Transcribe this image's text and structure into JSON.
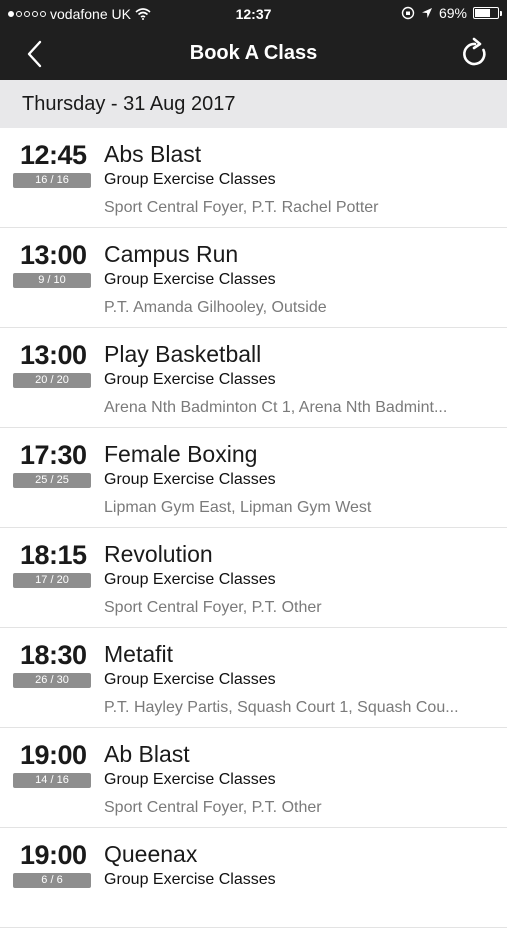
{
  "status_bar": {
    "carrier": "vodafone UK",
    "signal_dots_on": 1,
    "time": "12:37",
    "battery": "69%",
    "battery_level": 0.69
  },
  "nav": {
    "title": "Book A Class",
    "back_icon": "chevron-left-icon",
    "refresh_icon": "refresh-icon"
  },
  "date_header": "Thursday - 31 Aug 2017",
  "classes": [
    {
      "time": "12:45",
      "capacity": "16 / 16",
      "name": "Abs Blast",
      "category": "Group Exercise Classes",
      "location": "Sport Central  Foyer, P.T. Rachel Potter"
    },
    {
      "time": "13:00",
      "capacity": "9 / 10",
      "name": "Campus Run",
      "category": "Group Exercise Classes",
      "location": "P.T. Amanda Gilhooley, Outside"
    },
    {
      "time": "13:00",
      "capacity": "20 / 20",
      "name": "Play Basketball",
      "category": "Group Exercise Classes",
      "location": "Arena Nth Badminton Ct 1, Arena Nth Badmint..."
    },
    {
      "time": "17:30",
      "capacity": "25 / 25",
      "name": "Female Boxing",
      "category": "Group Exercise Classes",
      "location": "Lipman Gym East, Lipman Gym West"
    },
    {
      "time": "18:15",
      "capacity": "17 / 20",
      "name": "Revolution",
      "category": "Group Exercise Classes",
      "location": "Sport Central  Foyer, P.T. Other"
    },
    {
      "time": "18:30",
      "capacity": "26 / 30",
      "name": "Metafit",
      "category": "Group Exercise Classes",
      "location": "P.T. Hayley Partis, Squash Court 1, Squash Cou..."
    },
    {
      "time": "19:00",
      "capacity": "14 / 16",
      "name": "Ab Blast",
      "category": "Group Exercise Classes",
      "location": "Sport Central  Foyer, P.T. Other"
    },
    {
      "time": "19:00",
      "capacity": "6 / 6",
      "name": "Queenax",
      "category": "Group Exercise Classes",
      "location": ""
    }
  ]
}
